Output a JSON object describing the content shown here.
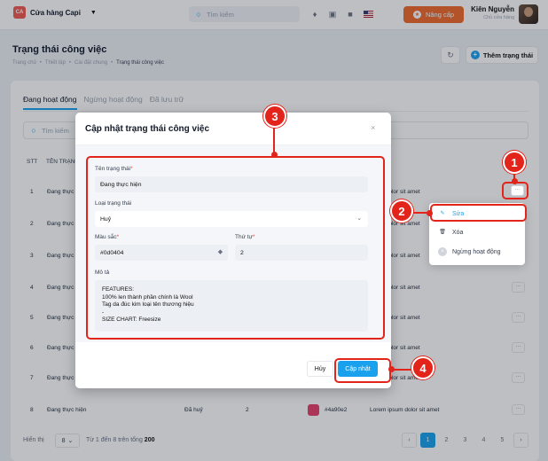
{
  "topbar": {
    "store_logo": "CA",
    "store_name": "Cửa hàng Capi",
    "search_placeholder": "Tìm kiếm",
    "upgrade_label": "Nâng cấp",
    "user_name": "Kiên Nguyễn",
    "user_role": "Chủ cửa hàng"
  },
  "header": {
    "title": "Trạng thái công việc",
    "breadcrumb": [
      "Trang chủ",
      "Thiết lập",
      "Cài đặt chung",
      "Trạng thái công việc"
    ],
    "add_label": "Thêm trạng thái"
  },
  "tabs": [
    "Đang hoạt động",
    "Ngừng hoạt động",
    "Đã lưu trữ"
  ],
  "table": {
    "search_placeholder": "Tìm kiếm",
    "col_stt": "STT",
    "col_name": "TÊN TRẠNG",
    "rows": [
      {
        "stt": "1",
        "name": "Đang thực",
        "desc": "psum dolor sit amet"
      },
      {
        "stt": "2",
        "name": "Đang thực",
        "desc": "psum dolor sit amet"
      },
      {
        "stt": "3",
        "name": "Đang thực",
        "desc": "psum dolor sit amet"
      },
      {
        "stt": "4",
        "name": "Đang thực",
        "desc": "psum dolor sit amet"
      },
      {
        "stt": "5",
        "name": "Đang thực",
        "desc": "psum dolor sit amet"
      },
      {
        "stt": "6",
        "name": "Đang thực",
        "desc": "psum dolor sit amet"
      },
      {
        "stt": "7",
        "name": "Đang thực",
        "desc": "psum dolor sit amet"
      },
      {
        "stt": "8",
        "name": "Đang thực hiện",
        "type": "Đã huỷ",
        "order": "2",
        "color": "#e8416a",
        "hex": "#4a90e2",
        "desc": "Lorem ipsum dolor sit amet"
      }
    ],
    "more_label": "···"
  },
  "footer": {
    "show_label": "Hiển thị",
    "page_size": "8",
    "info_prefix": "Từ 1 đến 8 trên tổng",
    "total": "200",
    "pages": [
      "1",
      "2",
      "3",
      "4",
      "5"
    ],
    "prev": "‹",
    "next": "›"
  },
  "modal": {
    "title": "Cập nhật trạng thái công việc",
    "close": "×",
    "name_label": "Tên trạng thái",
    "name_value": "Đang thực hiện",
    "type_label": "Loại trạng thái",
    "type_value": "Huỷ",
    "color_label": "Màu sắc",
    "color_value": "#0d0404",
    "order_label": "Thứ tự",
    "order_value": "2",
    "desc_label": "Mô tả",
    "desc_lines": [
      "FEATURES:",
      "100% len thành phần chính là Wool",
      "Tag da đúc kim loại tên thương hiệu",
      "-",
      "SIZE CHART: Freesize"
    ],
    "cancel_label": "Hủy",
    "update_label": "Cập nhật"
  },
  "menu": {
    "edit": "Sửa",
    "delete": "Xóa",
    "deactivate": "Ngừng hoạt động"
  },
  "annotations": [
    "1",
    "2",
    "3",
    "4"
  ],
  "colors": {
    "accent": "#1aa1ee",
    "upgrade": "#f06a2b",
    "annotation": "#e2241b"
  }
}
